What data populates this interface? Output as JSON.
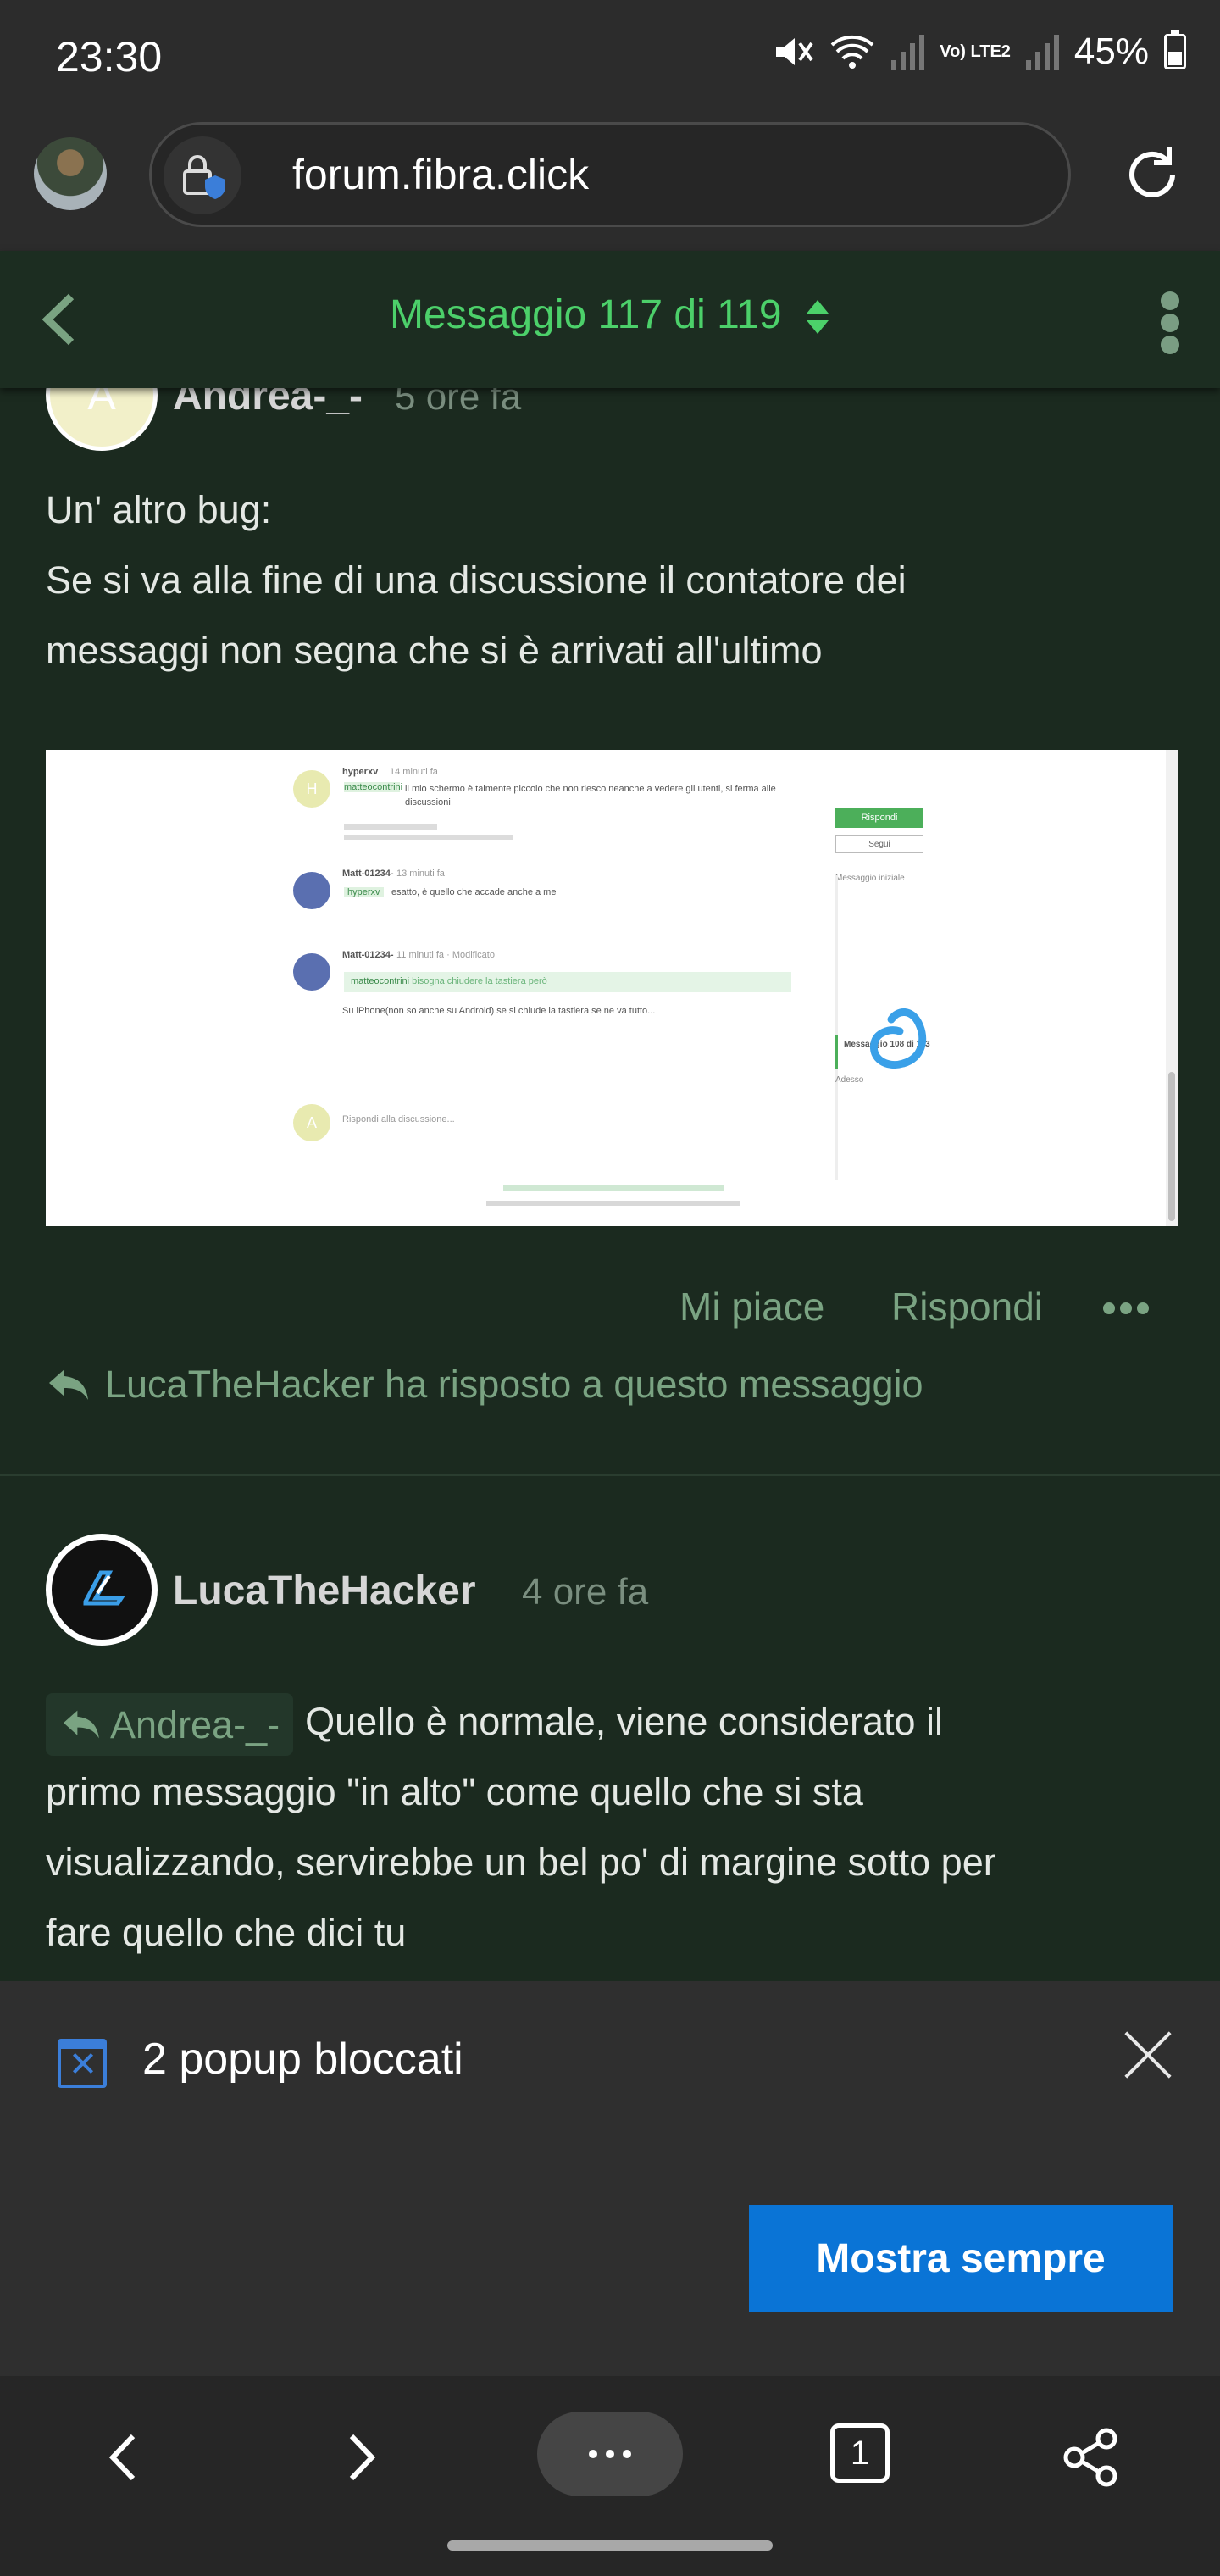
{
  "status_bar": {
    "time": "23:30",
    "battery": "45%",
    "network_label": "Vo) LTE2"
  },
  "browser": {
    "url": "forum.fibra.click"
  },
  "forum_header": {
    "counter": "Messaggio 117 di 119"
  },
  "post1": {
    "author": "Andrea-_-",
    "time": "5 ore fa",
    "avatar_letter": "A",
    "body_lines": [
      "Un' altro bug:",
      "Se si va alla fine di una discussione il contatore dei",
      "messaggi non segna che si è arrivati all'ultimo"
    ],
    "screenshot": {
      "u1_name": "hyperxv",
      "u1_time": "14 minuti fa",
      "u1_text": "il mio schermo è talmente piccolo che non riesco neanche a vedere gli utenti, si ferma alle discussioni",
      "u1_quote": "matteocontrini",
      "u2_name": "Matt-01234-",
      "u2_time": "13 minuti fa",
      "u2_quote": "hyperxv",
      "u2_text": "esatto, è quello che accade anche a me",
      "u3_name": "Matt-01234-",
      "u3_time": "11 minuti fa · Modificato",
      "u3_quote": "matteocontrini",
      "u3_quote_text": "bisogna chiudere la tastiera però",
      "u3_text": "Su iPhone(non so anche su Android) se si chiude la tastiera se ne va tutto...",
      "reply_placeholder": "Rispondi alla discussione...",
      "reply_avatar_letter": "A",
      "side_button": "Rispondi",
      "side_follow": "Segui",
      "side_first": "Messaggio iniziale",
      "side_counter": "Messaggio 108 di 113",
      "side_latest": "Adesso",
      "u1_avatar_letter": "H"
    },
    "actions": {
      "like": "Mi piace",
      "reply": "Rispondi"
    },
    "reply_note": "LucaTheHacker ha risposto a questo messaggio"
  },
  "post2": {
    "author": "LucaTheHacker",
    "time": "4 ore fa",
    "quote_chip": "Andrea-_-",
    "body_first": "Quello è normale, viene considerato il",
    "body_lines": [
      "primo messaggio \"in alto\" come quello che si sta",
      "visualizzando, servirebbe un bel po' di margine sotto per",
      "fare quello che dici tu"
    ]
  },
  "popup": {
    "text": "2 popup bloccati",
    "button": "Mostra sempre"
  },
  "bottom_nav": {
    "tab_count": "1"
  },
  "colors": {
    "accent_green": "#4cd06a",
    "muted_green": "#7aa382",
    "background": "#1b2a1f",
    "button_blue": "#0a74d6"
  }
}
